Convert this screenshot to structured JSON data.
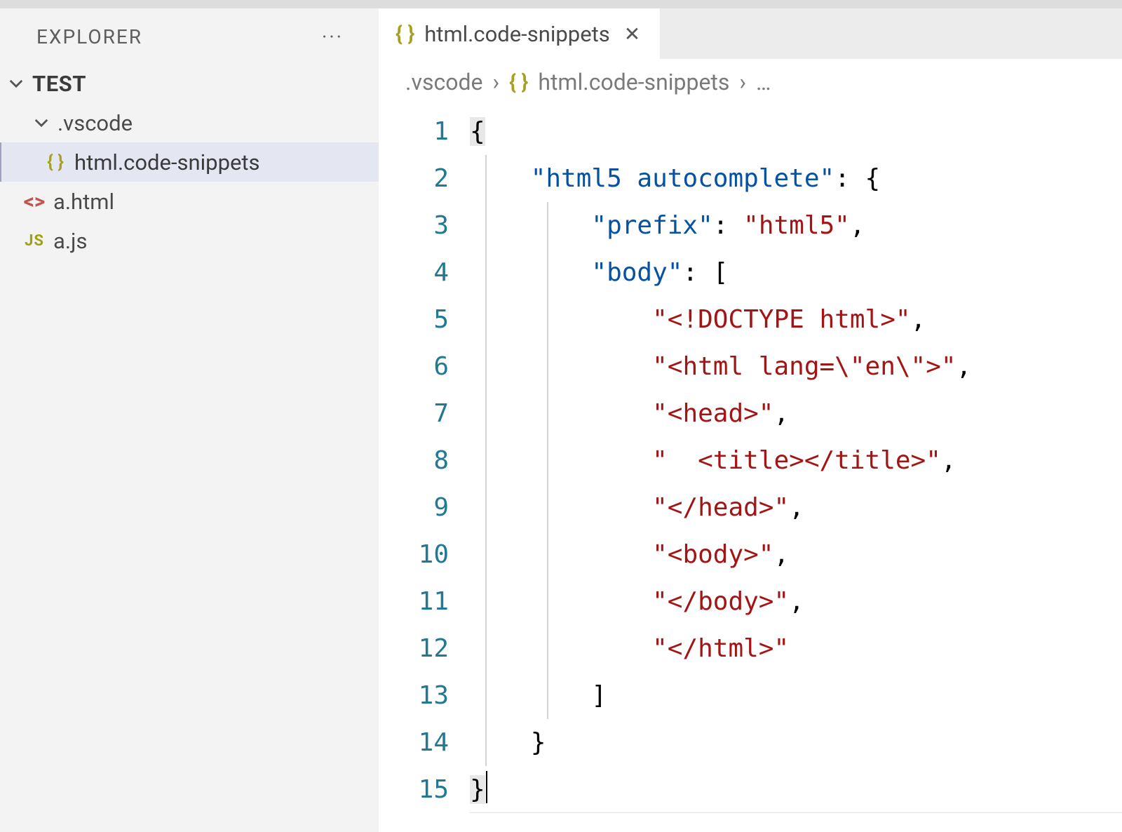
{
  "sidebar": {
    "title": "EXPLORER",
    "actions": "···",
    "root": "TEST",
    "tree": [
      {
        "name": ".vscode",
        "kind": "folder"
      },
      {
        "name": "html.code-snippets",
        "kind": "json",
        "selected": true
      },
      {
        "name": "a.html",
        "kind": "html"
      },
      {
        "name": "a.js",
        "kind": "js"
      }
    ]
  },
  "tab": {
    "icon": "json",
    "label": "html.code-snippets"
  },
  "breadcrumbs": {
    "seg1": ".vscode",
    "seg2": "html.code-snippets",
    "trailing": "…"
  },
  "editor": {
    "lineCount": 15,
    "tokens": [
      [
        {
          "t": "p",
          "v": "{"
        }
      ],
      [
        {
          "t": "sp",
          "v": "    "
        },
        {
          "t": "k",
          "v": "\"html5 autocomplete\""
        },
        {
          "t": "p",
          "v": ": {"
        }
      ],
      [
        {
          "t": "sp",
          "v": "        "
        },
        {
          "t": "k",
          "v": "\"prefix\""
        },
        {
          "t": "p",
          "v": ": "
        },
        {
          "t": "s",
          "v": "\"html5\""
        },
        {
          "t": "p",
          "v": ","
        }
      ],
      [
        {
          "t": "sp",
          "v": "        "
        },
        {
          "t": "k",
          "v": "\"body\""
        },
        {
          "t": "p",
          "v": ": ["
        }
      ],
      [
        {
          "t": "sp",
          "v": "            "
        },
        {
          "t": "s",
          "v": "\"<!DOCTYPE html>\""
        },
        {
          "t": "p",
          "v": ","
        }
      ],
      [
        {
          "t": "sp",
          "v": "            "
        },
        {
          "t": "s",
          "v": "\"<html lang=\\\"en\\\">\""
        },
        {
          "t": "p",
          "v": ","
        }
      ],
      [
        {
          "t": "sp",
          "v": "            "
        },
        {
          "t": "s",
          "v": "\"<head>\""
        },
        {
          "t": "p",
          "v": ","
        }
      ],
      [
        {
          "t": "sp",
          "v": "            "
        },
        {
          "t": "s",
          "v": "\"  <title></title>\""
        },
        {
          "t": "p",
          "v": ","
        }
      ],
      [
        {
          "t": "sp",
          "v": "            "
        },
        {
          "t": "s",
          "v": "\"</head>\""
        },
        {
          "t": "p",
          "v": ","
        }
      ],
      [
        {
          "t": "sp",
          "v": "            "
        },
        {
          "t": "s",
          "v": "\"<body>\""
        },
        {
          "t": "p",
          "v": ","
        }
      ],
      [
        {
          "t": "sp",
          "v": "            "
        },
        {
          "t": "s",
          "v": "\"</body>\""
        },
        {
          "t": "p",
          "v": ","
        }
      ],
      [
        {
          "t": "sp",
          "v": "            "
        },
        {
          "t": "s",
          "v": "\"</html>\""
        }
      ],
      [
        {
          "t": "sp",
          "v": "        "
        },
        {
          "t": "p",
          "v": "]"
        }
      ],
      [
        {
          "t": "sp",
          "v": "    "
        },
        {
          "t": "p",
          "v": "}"
        }
      ],
      [
        {
          "t": "p",
          "v": "}"
        }
      ]
    ]
  }
}
